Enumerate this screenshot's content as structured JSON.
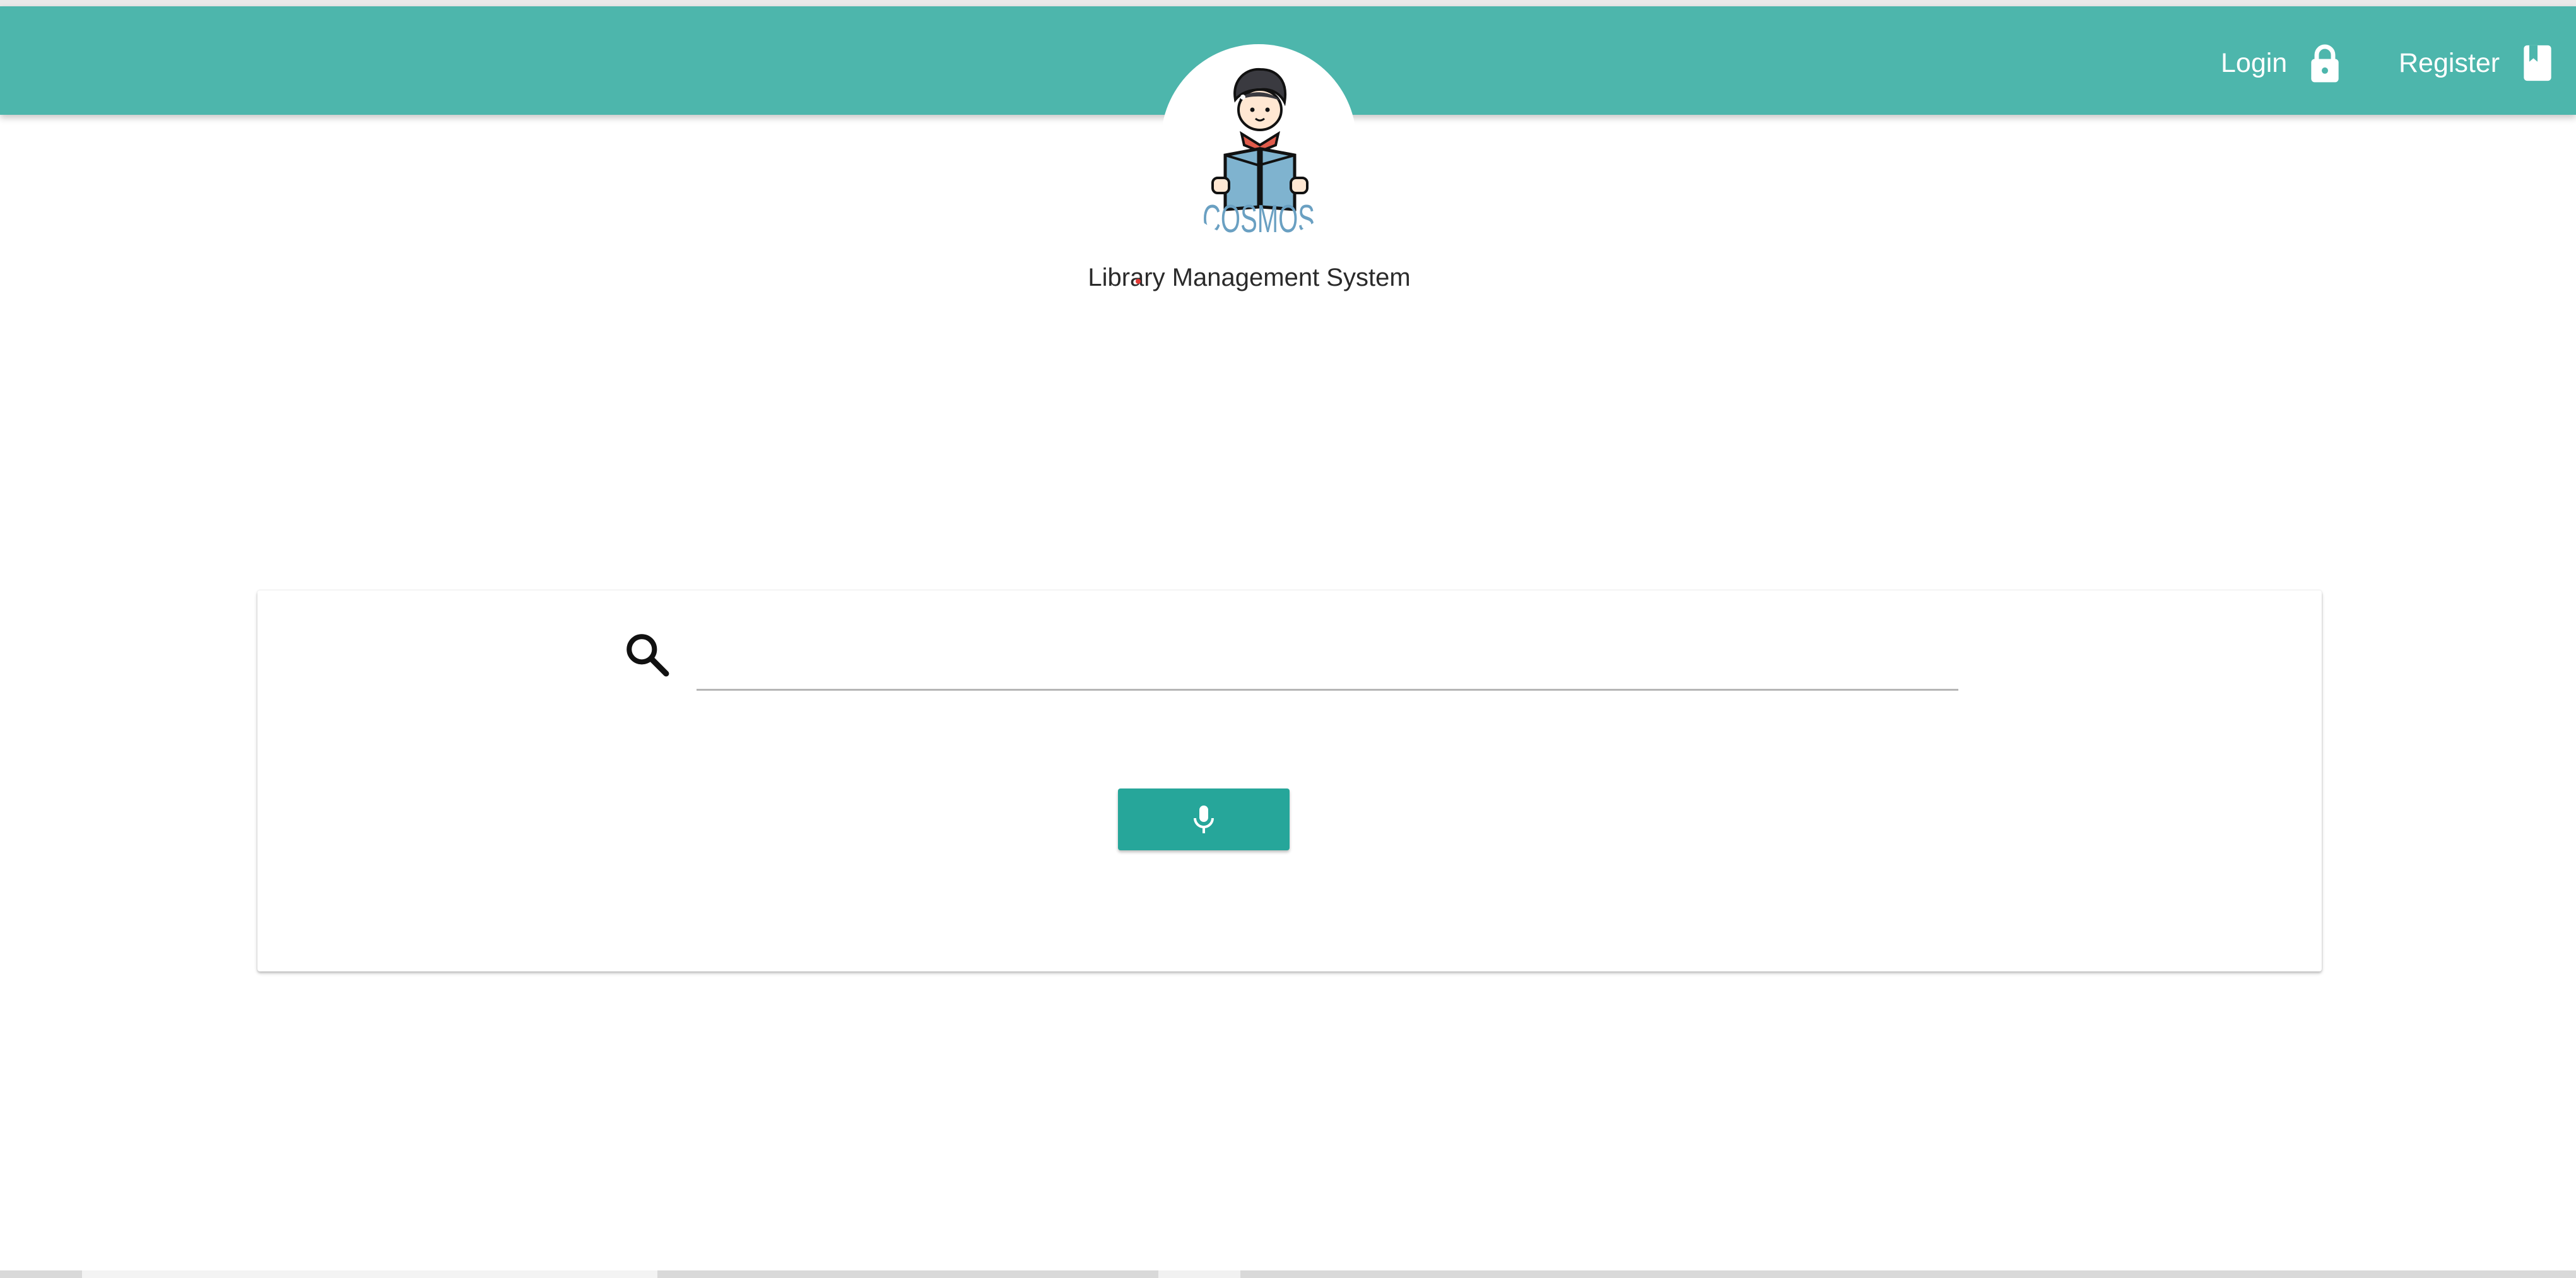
{
  "header": {
    "login_label": "Login",
    "register_label": "Register",
    "login_icon": "lock-icon",
    "register_icon": "book-icon",
    "background_color": "#4db6ac"
  },
  "logo": {
    "text": "COSMOS",
    "icon": "reading-boy-logo"
  },
  "subtitle": "Library Management System",
  "search": {
    "value": "",
    "placeholder": "",
    "icon": "search-icon"
  },
  "voice_button": {
    "icon": "microphone-icon",
    "color": "#26a69a"
  }
}
